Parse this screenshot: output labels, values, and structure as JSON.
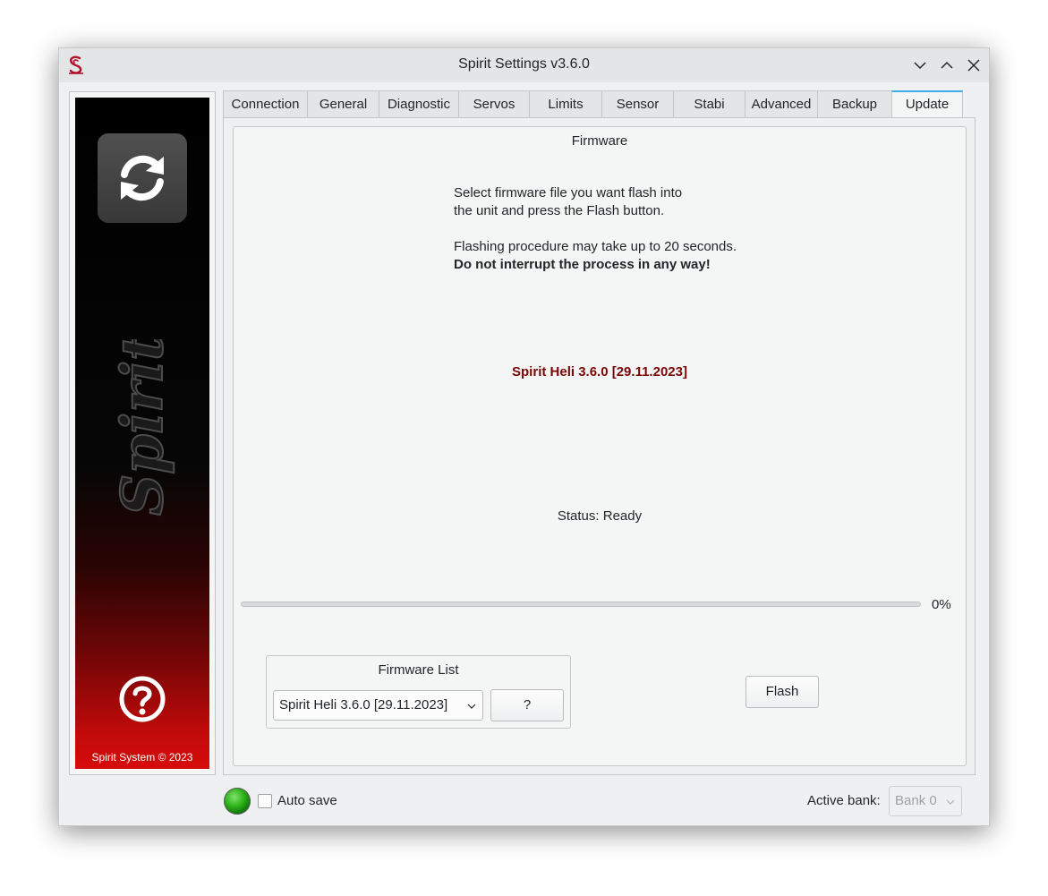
{
  "window": {
    "title": "Spirit Settings v3.6.0"
  },
  "sidebar": {
    "copyright": "Spirit System © 2023"
  },
  "tabs": [
    {
      "label": "Connection"
    },
    {
      "label": "General"
    },
    {
      "label": "Diagnostic"
    },
    {
      "label": "Servos"
    },
    {
      "label": "Limits"
    },
    {
      "label": "Sensor"
    },
    {
      "label": "Stabi"
    },
    {
      "label": "Advanced"
    },
    {
      "label": "Backup"
    },
    {
      "label": "Update",
      "active": true
    }
  ],
  "firmware": {
    "group_title": "Firmware",
    "instructions": {
      "line1": "Select firmware file you want flash into",
      "line2": "the unit and press the Flash button.",
      "line3": "Flashing procedure may take up to 20 seconds.",
      "line4": "Do not interrupt the process in any way!"
    },
    "version": "Spirit Heli 3.6.0 [29.11.2023]",
    "status_label": "Status:",
    "status_value": "Ready",
    "progress": 0,
    "progress_text": "0%"
  },
  "firmware_list": {
    "title": "Firmware List",
    "selected": "Spirit Heli 3.6.0 [29.11.2023]",
    "help_button": "?"
  },
  "flash_button": "Flash",
  "footer": {
    "auto_save_label": "Auto save",
    "auto_save_checked": false,
    "active_bank_label": "Active bank:",
    "active_bank_value": "Bank 0"
  },
  "colors": {
    "accent": "#3daee9",
    "firmware_version": "#7a0606",
    "status_led": "#2fb31a"
  },
  "icons": [
    "app-logo-icon",
    "minimize-icon",
    "maximize-icon",
    "close-icon",
    "sync-icon",
    "spirit-brand-logo",
    "help-icon",
    "chevron-down-icon",
    "status-led-icon"
  ]
}
